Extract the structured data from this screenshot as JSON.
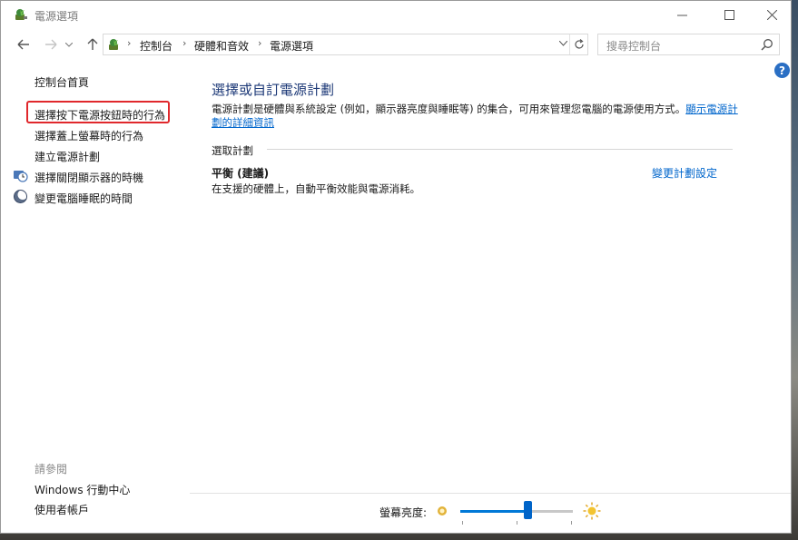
{
  "window": {
    "title": "電源選項",
    "controls": {
      "minimize": "—",
      "maximize": "☐",
      "close": "✕"
    }
  },
  "nav": {
    "back_icon": "back-arrow-icon",
    "forward_icon": "forward-arrow-icon",
    "up_icon": "up-arrow-icon",
    "breadcrumbs": [
      "控制台",
      "硬體和音效",
      "電源選項"
    ],
    "search_placeholder": "搜尋控制台"
  },
  "left_pane": {
    "home": "控制台首頁",
    "links": [
      "選擇按下電源按鈕時的行為",
      "選擇蓋上螢幕時的行為",
      "建立電源計劃",
      "選擇關閉顯示器的時機",
      "變更電腦睡眠的時間"
    ],
    "see_also_label": "請參閱",
    "see_also": [
      "Windows 行動中心",
      "使用者帳戶"
    ]
  },
  "main": {
    "title": "選擇或自訂電源計劃",
    "description": "電源計劃是硬體與系統設定 (例如，顯示器亮度與睡眠等) 的集合，可用來管理您電腦的電源使用方式。",
    "description_link": "顯示電源計劃的詳細資訊",
    "section_label": "選取計劃",
    "plan": {
      "name": "平衡 (建議)",
      "description": "在支援的硬體上，自動平衡效能與電源消耗。",
      "change_link": "變更計劃設定"
    }
  },
  "brightness": {
    "label": "螢幕亮度:",
    "level": 0.6
  },
  "colors": {
    "highlight": "#e0282c",
    "link": "#0066cc",
    "title": "#1e3a78",
    "slider": "#0078d7"
  }
}
